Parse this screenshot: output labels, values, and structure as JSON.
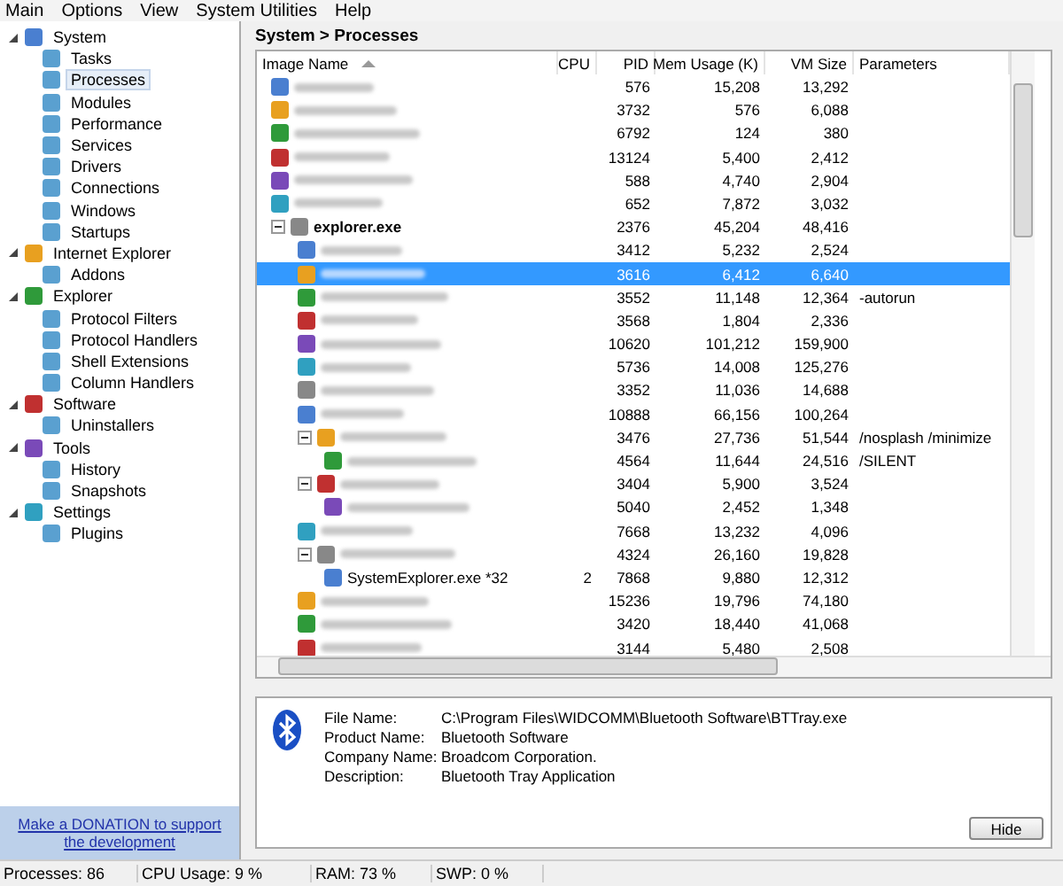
{
  "menu": [
    "Main",
    "Options",
    "View",
    "System Utilities",
    "Help"
  ],
  "sidebar": {
    "items": [
      {
        "label": "System",
        "expanded": true,
        "children": [
          {
            "label": "Tasks",
            "selected": false
          },
          {
            "label": "Processes",
            "selected": true
          },
          {
            "label": "Modules",
            "selected": false
          },
          {
            "label": "Performance",
            "selected": false
          },
          {
            "label": "Services",
            "selected": false
          },
          {
            "label": "Drivers",
            "selected": false
          },
          {
            "label": "Connections",
            "selected": false
          },
          {
            "label": "Windows",
            "selected": false
          },
          {
            "label": "Startups",
            "selected": false
          }
        ]
      },
      {
        "label": "Internet Explorer",
        "expanded": true,
        "children": [
          {
            "label": "Addons",
            "selected": false
          }
        ]
      },
      {
        "label": "Explorer",
        "expanded": true,
        "children": [
          {
            "label": "Protocol Filters",
            "selected": false
          },
          {
            "label": "Protocol Handlers",
            "selected": false
          },
          {
            "label": "Shell Extensions",
            "selected": false
          },
          {
            "label": "Column Handlers",
            "selected": false
          }
        ]
      },
      {
        "label": "Software",
        "expanded": true,
        "children": [
          {
            "label": "Uninstallers",
            "selected": false
          }
        ]
      },
      {
        "label": "Tools",
        "expanded": true,
        "children": [
          {
            "label": "History",
            "selected": false
          },
          {
            "label": "Snapshots",
            "selected": false
          }
        ]
      },
      {
        "label": "Settings",
        "expanded": true,
        "children": [
          {
            "label": "Plugins",
            "selected": false
          }
        ]
      }
    ],
    "donation_link": "Make a DONATION to support the development"
  },
  "breadcrumb": "System > Processes",
  "table": {
    "columns": [
      {
        "label": "Image Name",
        "sorted": true
      },
      {
        "label": "CPU",
        "sorted": false
      },
      {
        "label": "PID",
        "sorted": false
      },
      {
        "label": "Mem Usage (K)",
        "sorted": false
      },
      {
        "label": "VM Size",
        "sorted": false
      },
      {
        "label": "Parameters",
        "sorted": false
      }
    ],
    "rows": [
      {
        "pid": "576",
        "mem": "15,208",
        "vm": "13,292",
        "selected": false
      },
      {
        "pid": "3732",
        "mem": "576",
        "vm": "6,088",
        "selected": false
      },
      {
        "pid": "6792",
        "mem": "124",
        "vm": "380",
        "selected": false
      },
      {
        "pid": "13124",
        "mem": "5,400",
        "vm": "2,412",
        "selected": false
      },
      {
        "pid": "588",
        "mem": "4,740",
        "vm": "2,904",
        "selected": false
      },
      {
        "pid": "652",
        "mem": "7,872",
        "vm": "3,032",
        "selected": false
      },
      {
        "name": "explorer.exe",
        "pid": "2376",
        "mem": "45,204",
        "vm": "48,416",
        "selected": false,
        "expanded": true,
        "children": [
          {
            "pid": "3412",
            "mem": "5,232",
            "vm": "2,524",
            "selected": false
          },
          {
            "pid": "3616",
            "mem": "6,412",
            "vm": "6,640",
            "selected": true
          },
          {
            "pid": "3552",
            "mem": "11,148",
            "vm": "12,364",
            "params": "-autorun",
            "selected": false
          },
          {
            "pid": "3568",
            "mem": "1,804",
            "vm": "2,336",
            "selected": false
          },
          {
            "pid": "10620",
            "mem": "101,212",
            "vm": "159,900",
            "selected": false
          },
          {
            "pid": "5736",
            "mem": "14,008",
            "vm": "125,276",
            "selected": false
          },
          {
            "pid": "3352",
            "mem": "11,036",
            "vm": "14,688",
            "selected": false
          },
          {
            "pid": "10888",
            "mem": "66,156",
            "vm": "100,264",
            "selected": false
          },
          {
            "pid": "3476",
            "mem": "27,736",
            "vm": "51,544",
            "params": "/nosplash /minimize",
            "selected": false,
            "expanded": true,
            "children": [
              {
                "pid": "4564",
                "mem": "11,644",
                "vm": "24,516",
                "params": "/SILENT",
                "selected": false
              }
            ]
          },
          {
            "pid": "3404",
            "mem": "5,900",
            "vm": "3,524",
            "selected": false,
            "expanded": true,
            "children": [
              {
                "pid": "5040",
                "mem": "2,452",
                "vm": "1,348",
                "selected": false
              }
            ]
          },
          {
            "pid": "7668",
            "mem": "13,232",
            "vm": "4,096",
            "selected": false
          },
          {
            "pid": "4324",
            "mem": "26,160",
            "vm": "19,828",
            "selected": false,
            "expanded": true,
            "children": [
              {
                "name": "SystemExplorer.exe *32",
                "cpu": "2",
                "pid": "7868",
                "mem": "9,880",
                "vm": "12,312",
                "selected": false
              }
            ]
          },
          {
            "pid": "15236",
            "mem": "19,796",
            "vm": "74,180",
            "selected": false
          },
          {
            "pid": "3420",
            "mem": "18,440",
            "vm": "41,068",
            "selected": false
          },
          {
            "pid": "3144",
            "mem": "5,480",
            "vm": "2,508",
            "selected": false
          }
        ]
      }
    ]
  },
  "details": {
    "fields": [
      {
        "label": "File Name:",
        "value": "C:\\Program Files\\WIDCOMM\\Bluetooth Software\\BTTray.exe"
      },
      {
        "label": "Product Name:",
        "value": "Bluetooth Software"
      },
      {
        "label": "Company Name:",
        "value": "Broadcom Corporation."
      },
      {
        "label": "Description:",
        "value": "Bluetooth Tray Application"
      }
    ],
    "hide_button": "Hide"
  },
  "status_bar": [
    "Processes: 86",
    "CPU Usage: 9 %",
    "RAM: 73 %",
    "SWP: 0 %"
  ]
}
